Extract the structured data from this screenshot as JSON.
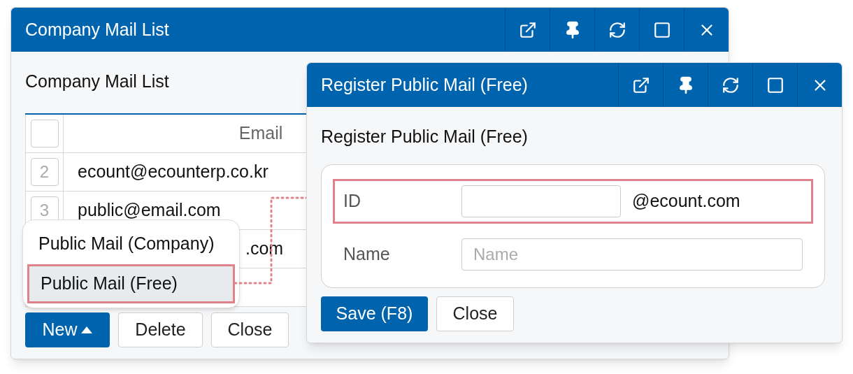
{
  "main_window": {
    "title": "Company Mail List",
    "heading": "Company Mail List",
    "table": {
      "select_all": {
        "checked": false
      },
      "columns": [
        "Email"
      ],
      "rows": [
        {
          "number": "2",
          "email": "ecount@ecounterp.co.kr"
        },
        {
          "number": "3",
          "email": "public@email.com"
        },
        {
          "email": ".com"
        }
      ]
    },
    "buttons": [
      {
        "label": "New",
        "primary": true,
        "has_menu": true
      },
      {
        "label": "Delete",
        "primary": false,
        "has_menu": false
      },
      {
        "label": "Close",
        "primary": false,
        "has_menu": false
      }
    ]
  },
  "menu": {
    "items": [
      {
        "label": "Public Mail (Company)",
        "selected": false
      },
      {
        "label": "Public Mail (Free)",
        "selected": true
      }
    ]
  },
  "dialog": {
    "title": "Register Public Mail (Free)",
    "heading": "Register Public Mail (Free)",
    "fields": [
      {
        "label": "ID",
        "kind": "suffix",
        "suffix": "@ecount.com",
        "highlighted": true
      },
      {
        "label": "Name",
        "kind": "text",
        "placeholder": "Name",
        "highlighted": false
      }
    ],
    "buttons": [
      {
        "label": "Save (F8)",
        "primary": true
      },
      {
        "label": "Close",
        "primary": false
      }
    ]
  }
}
